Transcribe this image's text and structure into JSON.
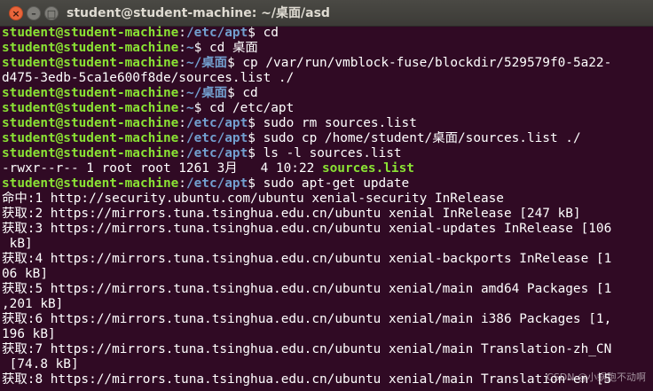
{
  "window": {
    "title": "student@student-machine: ~/桌面/asd",
    "close_label": "×",
    "min_label": "–",
    "max_label": "□"
  },
  "prompt": {
    "user_host": "student@student-machine",
    "sep": ":",
    "end": "$"
  },
  "lines": [
    {
      "type": "prompt",
      "path": "/etc/apt",
      "cmd": " cd"
    },
    {
      "type": "prompt",
      "path": "~",
      "cmd": " cd 桌面"
    },
    {
      "type": "prompt",
      "path": "~/桌面",
      "cmd": " cp /var/run/vmblock-fuse/blockdir/529579f0-5a22-"
    },
    {
      "type": "text",
      "text": "d475-3edb-5ca1e600f8de/sources.list ./"
    },
    {
      "type": "prompt",
      "path": "~/桌面",
      "cmd": " cd"
    },
    {
      "type": "prompt",
      "path": "~",
      "cmd": " cd /etc/apt"
    },
    {
      "type": "prompt",
      "path": "/etc/apt",
      "cmd": " sudo rm sources.list"
    },
    {
      "type": "prompt",
      "path": "/etc/apt",
      "cmd": " sudo cp /home/student/桌面/sources.list ./"
    },
    {
      "type": "prompt",
      "path": "/etc/apt",
      "cmd": " ls -l sources.list"
    },
    {
      "type": "ls",
      "text": "-rwxr--r-- 1 root root 1261 3月   4 10:22 ",
      "file": "sources.list"
    },
    {
      "type": "prompt",
      "path": "/etc/apt",
      "cmd": " sudo apt-get update"
    },
    {
      "type": "text",
      "text": "命中:1 http://security.ubuntu.com/ubuntu xenial-security InRelease"
    },
    {
      "type": "text",
      "text": "获取:2 https://mirrors.tuna.tsinghua.edu.cn/ubuntu xenial InRelease [247 kB]"
    },
    {
      "type": "text",
      "text": "获取:3 https://mirrors.tuna.tsinghua.edu.cn/ubuntu xenial-updates InRelease [106"
    },
    {
      "type": "text",
      "text": " kB]"
    },
    {
      "type": "text",
      "text": "获取:4 https://mirrors.tuna.tsinghua.edu.cn/ubuntu xenial-backports InRelease [1"
    },
    {
      "type": "text",
      "text": "06 kB]"
    },
    {
      "type": "text",
      "text": "获取:5 https://mirrors.tuna.tsinghua.edu.cn/ubuntu xenial/main amd64 Packages [1"
    },
    {
      "type": "text",
      "text": ",201 kB]"
    },
    {
      "type": "text",
      "text": "获取:6 https://mirrors.tuna.tsinghua.edu.cn/ubuntu xenial/main i386 Packages [1,"
    },
    {
      "type": "text",
      "text": "196 kB]"
    },
    {
      "type": "text",
      "text": "获取:7 https://mirrors.tuna.tsinghua.edu.cn/ubuntu xenial/main Translation-zh_CN"
    },
    {
      "type": "text",
      "text": " [74.8 kB]"
    },
    {
      "type": "text",
      "text": "获取:8 https://mirrors.tuna.tsinghua.edu.cn/ubuntu xenial/main Translation-en [5"
    }
  ],
  "watermark": "CSDN @小蜗跑不动啊",
  "colors": {
    "background": "#300a24",
    "user_host": "#8ae234",
    "path": "#729fcf",
    "text": "#ffffff"
  }
}
